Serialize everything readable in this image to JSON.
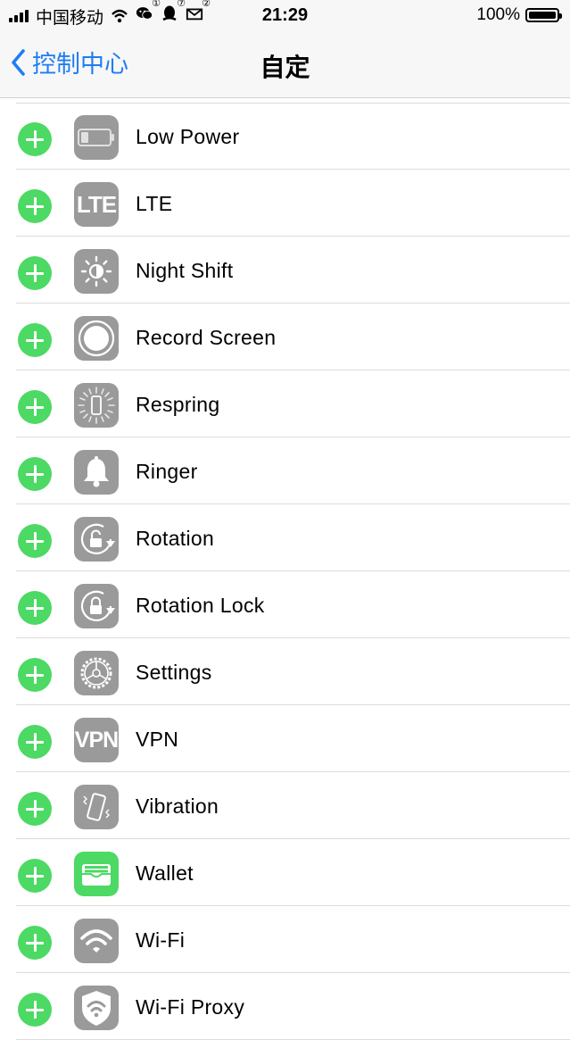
{
  "status_bar": {
    "carrier": "中国移动",
    "time": "21:29",
    "battery": "100%",
    "badges": [
      "①",
      "⑦",
      "②"
    ]
  },
  "nav": {
    "back_label": "控制中心",
    "title": "自定"
  },
  "items": [
    {
      "label": "Low Power",
      "icon": "battery-icon"
    },
    {
      "label": "LTE",
      "icon": "lte-icon",
      "icon_text": "LTE"
    },
    {
      "label": "Night Shift",
      "icon": "night-shift-icon"
    },
    {
      "label": "Record Screen",
      "icon": "record-screen-icon"
    },
    {
      "label": "Respring",
      "icon": "respring-icon"
    },
    {
      "label": "Ringer",
      "icon": "bell-icon"
    },
    {
      "label": "Rotation",
      "icon": "rotation-icon"
    },
    {
      "label": "Rotation Lock",
      "icon": "rotation-lock-icon"
    },
    {
      "label": "Settings",
      "icon": "gear-icon"
    },
    {
      "label": "VPN",
      "icon": "vpn-icon",
      "icon_text": "VPN"
    },
    {
      "label": "Vibration",
      "icon": "vibration-icon"
    },
    {
      "label": "Wallet",
      "icon": "wallet-icon"
    },
    {
      "label": "Wi-Fi",
      "icon": "wifi-icon"
    },
    {
      "label": "Wi-Fi Proxy",
      "icon": "wifi-proxy-icon"
    }
  ],
  "colors": {
    "accent": "#1e7df4",
    "add_button": "#4cd964",
    "tile_gray": "#9a9a9a",
    "wallet_tile": "#4cd964"
  }
}
